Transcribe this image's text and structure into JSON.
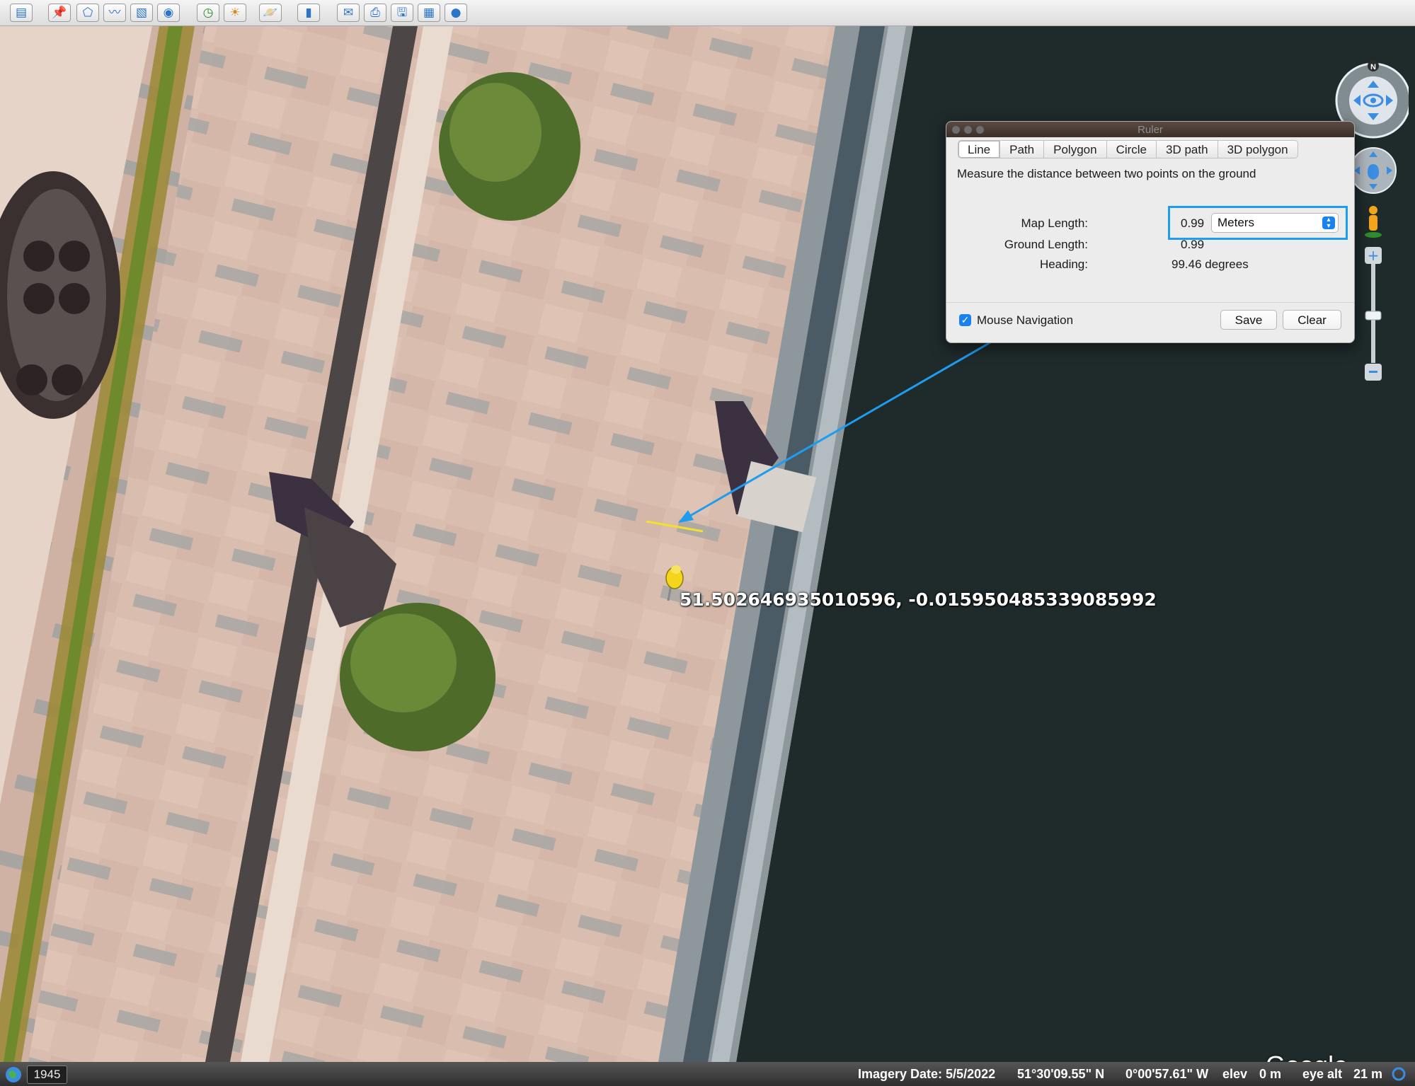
{
  "toolbar": {
    "buttons": [
      {
        "name": "sidebar-toggle-button",
        "icon": "sidebar-icon",
        "glyph": "▤",
        "color": "#2a74c9"
      },
      {
        "name": "add-placemark-button",
        "icon": "placemark-icon",
        "glyph": "📌",
        "color": "#c9a400"
      },
      {
        "name": "add-polygon-button",
        "icon": "polygon-icon",
        "glyph": "⬠",
        "color": "#2a74c9"
      },
      {
        "name": "add-path-button",
        "icon": "path-icon",
        "glyph": "〰",
        "color": "#2a74c9"
      },
      {
        "name": "add-image-overlay-button",
        "icon": "image-overlay-icon",
        "glyph": "▧",
        "color": "#2a74c9"
      },
      {
        "name": "record-tour-button",
        "icon": "camera-icon",
        "glyph": "◉",
        "color": "#2a74c9"
      },
      {
        "name": "historical-imagery-button",
        "icon": "clock-icon",
        "glyph": "◷",
        "color": "#2e8b2e"
      },
      {
        "name": "sunlight-button",
        "icon": "sun-icon",
        "glyph": "☀",
        "color": "#d9861a"
      },
      {
        "name": "switch-planet-button",
        "icon": "planet-icon",
        "glyph": "🪐",
        "color": "#c77a1a"
      },
      {
        "name": "ruler-button",
        "icon": "ruler-icon",
        "glyph": "▮",
        "color": "#2a74c9"
      },
      {
        "name": "email-button",
        "icon": "mail-icon",
        "glyph": "✉",
        "color": "#2a74c9"
      },
      {
        "name": "print-button",
        "icon": "printer-icon",
        "glyph": "⎙",
        "color": "#2a74c9"
      },
      {
        "name": "save-image-button",
        "icon": "save-image-icon",
        "glyph": "🖫",
        "color": "#2a74c9"
      },
      {
        "name": "view-in-maps-button",
        "icon": "maps-icon",
        "glyph": "▦",
        "color": "#2a74c9"
      },
      {
        "name": "earth-gallery-button",
        "icon": "globe-icon",
        "glyph": "●",
        "color": "#2a74c9"
      }
    ]
  },
  "map": {
    "placemark_coords": "51.502646935010596, -0.015950485339085992",
    "logo": "Google Earth",
    "colors": {
      "water": "#1f2a2a",
      "pavement": "#dcc0b0",
      "line": "#f2e12a",
      "arrow": "#1e9df0"
    }
  },
  "ruler": {
    "title": "Ruler",
    "tabs": [
      "Line",
      "Path",
      "Polygon",
      "Circle",
      "3D path",
      "3D polygon"
    ],
    "active_tab": "Line",
    "description": "Measure the distance between two points on the ground",
    "map_length_label": "Map Length:",
    "map_length_value": "0.99",
    "unit": "Meters",
    "ground_length_label": "Ground Length:",
    "ground_length_value": "0.99",
    "heading_label": "Heading:",
    "heading_value": "99.46 degrees",
    "mouse_navigation_label": "Mouse Navigation",
    "mouse_navigation_checked": true,
    "save_label": "Save",
    "clear_label": "Clear"
  },
  "navigation": {
    "north_label": "N"
  },
  "status": {
    "year": "1945",
    "imagery_date": "Imagery Date: 5/5/2022",
    "latitude": "51°30'09.55\" N",
    "longitude": "0°00'57.61\" W",
    "elev_label": "elev",
    "elev_value": "0 m",
    "eye_alt_label": "eye alt",
    "eye_alt_value": "21 m"
  }
}
